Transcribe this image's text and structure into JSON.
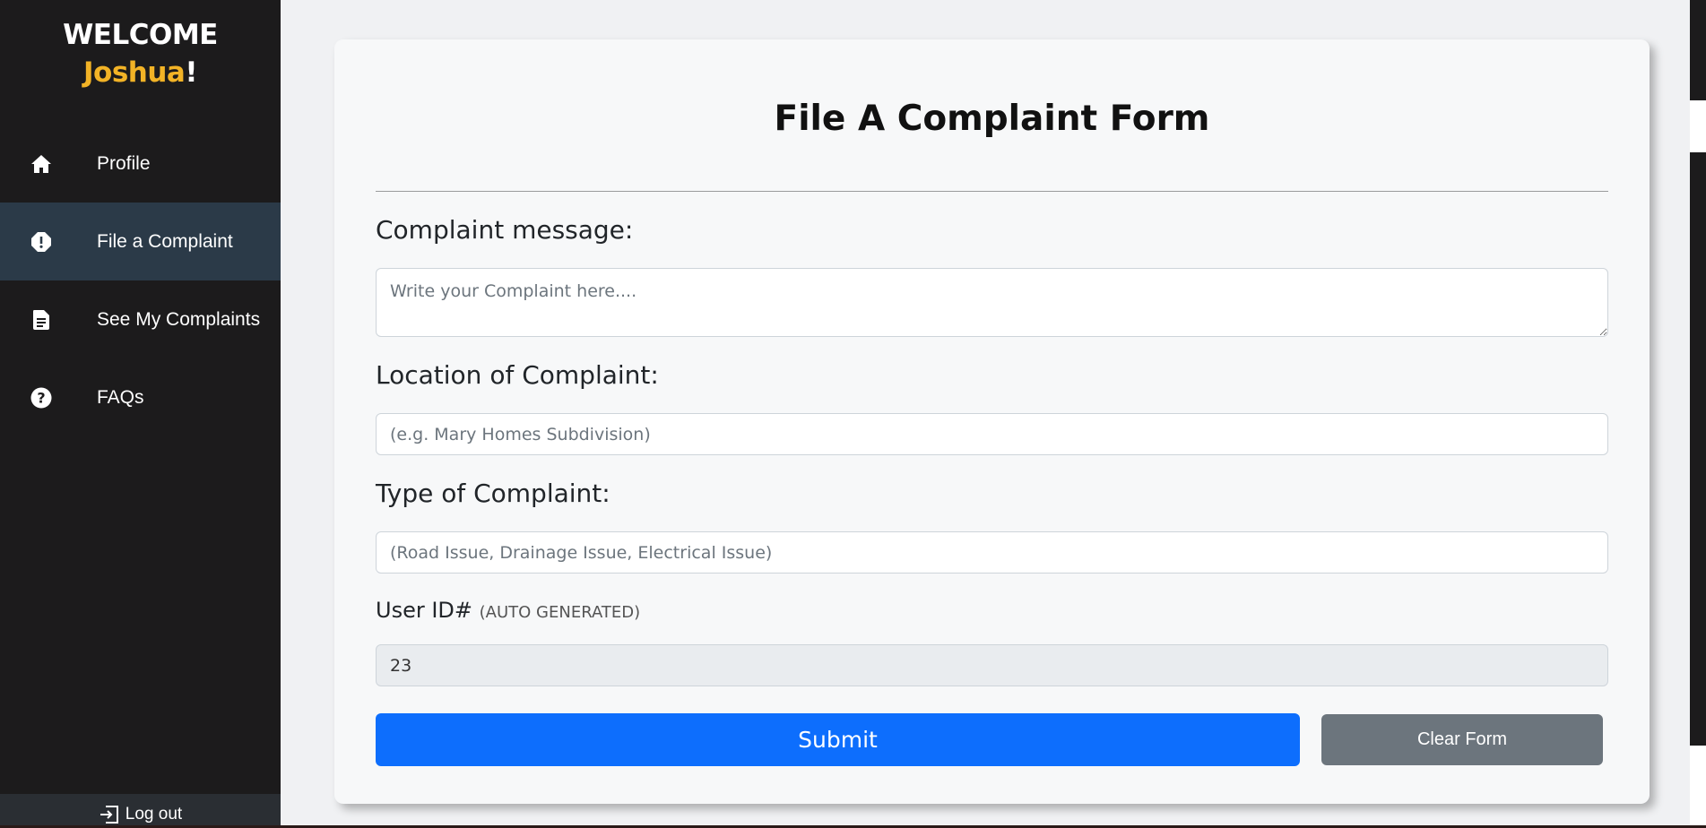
{
  "sidebar": {
    "welcome": "WELCOME",
    "user_name": "Joshua",
    "exclaim": "!",
    "items": [
      {
        "label": "Profile",
        "icon": "home-icon"
      },
      {
        "label": "File a Complaint",
        "icon": "alert-icon",
        "active": true
      },
      {
        "label": "See My Complaints",
        "icon": "document-icon"
      },
      {
        "label": "FAQs",
        "icon": "question-icon"
      }
    ],
    "logout_label": "Log out"
  },
  "form": {
    "title": "File A Complaint Form",
    "message_label": "Complaint message:",
    "message_placeholder": "Write your Complaint here....",
    "location_label": "Location of Complaint:",
    "location_placeholder": "(e.g. Mary Homes Subdivision)",
    "type_label": "Type of Complaint:",
    "type_placeholder": "(Road Issue, Drainage Issue, Electrical Issue)",
    "userid_label": "User ID#",
    "userid_note": "(AUTO GENERATED)",
    "userid_value": "23",
    "submit_label": "Submit",
    "clear_label": "Clear Form"
  },
  "colors": {
    "sidebar_bg": "#1c1b1c",
    "active_bg": "#2b3a48",
    "accent_name": "#f2b326",
    "primary": "#0d6efd",
    "secondary": "#6c757d"
  }
}
